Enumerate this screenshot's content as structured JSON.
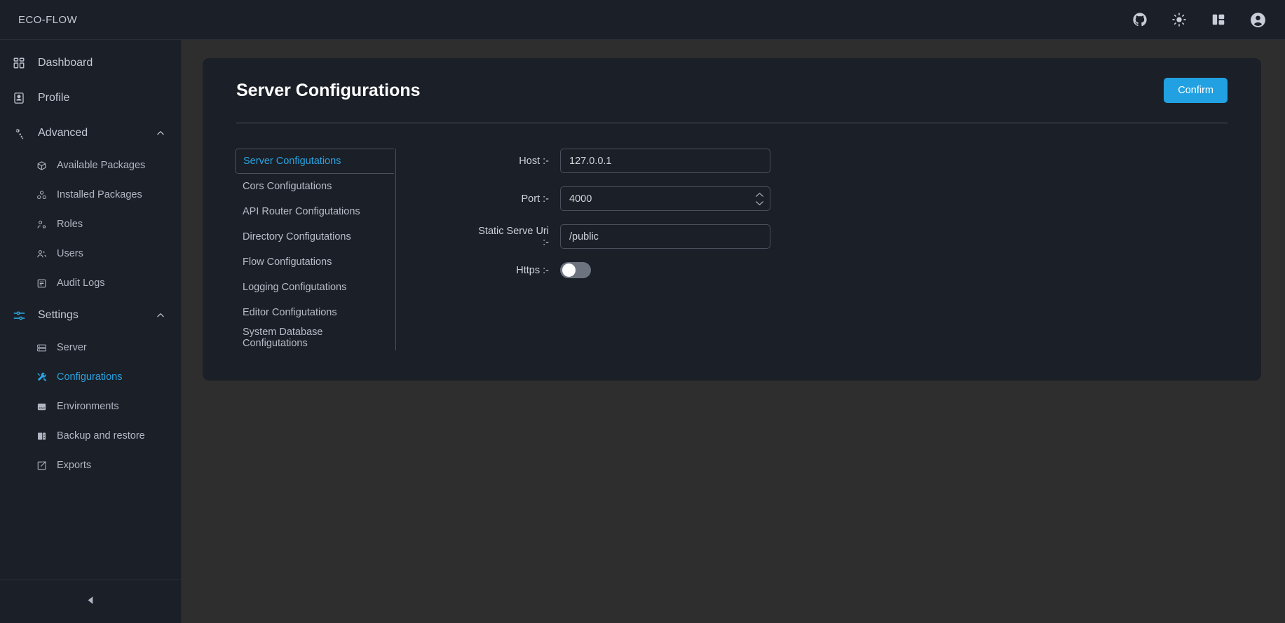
{
  "topbar": {
    "brand": "ECO-FLOW",
    "icons": [
      {
        "name": "github-icon",
        "title": "GitHub"
      },
      {
        "name": "sun-icon",
        "title": "Toggle theme"
      },
      {
        "name": "layout-panel-icon",
        "title": "Layout"
      },
      {
        "name": "account-circle-icon",
        "title": "Account"
      }
    ]
  },
  "sidebar": {
    "items": [
      {
        "label": "Dashboard",
        "icon": "dashboard-icon",
        "type": "nav"
      },
      {
        "label": "Profile",
        "icon": "profile-icon",
        "type": "nav"
      },
      {
        "label": "Advanced",
        "icon": "advanced-gear-icon",
        "type": "group",
        "expanded": true,
        "chevron": "chevron-up-icon"
      },
      {
        "label": "Available Packages",
        "icon": "package-icon",
        "type": "sub"
      },
      {
        "label": "Installed Packages",
        "icon": "installed-packages-icon",
        "type": "sub"
      },
      {
        "label": "Roles",
        "icon": "roles-icon",
        "type": "sub"
      },
      {
        "label": "Users",
        "icon": "users-icon",
        "type": "sub"
      },
      {
        "label": "Audit Logs",
        "icon": "audit-logs-icon",
        "type": "sub"
      },
      {
        "label": "Settings",
        "icon": "settings-sliders-icon",
        "type": "group",
        "expanded": true,
        "chevron": "chevron-up-icon"
      },
      {
        "label": "Server",
        "icon": "server-icon",
        "type": "sub"
      },
      {
        "label": "Configurations",
        "icon": "tools-icon",
        "type": "sub",
        "active": true
      },
      {
        "label": "Environments",
        "icon": "env-file-icon",
        "type": "sub"
      },
      {
        "label": "Backup and restore",
        "icon": "backup-restore-icon",
        "type": "sub"
      },
      {
        "label": "Exports",
        "icon": "exports-icon",
        "type": "sub"
      }
    ],
    "collapse": {
      "name": "collapse-sidebar-button",
      "icon": "caret-left-icon"
    }
  },
  "page": {
    "title": "Server Configurations",
    "confirm_label": "Confirm"
  },
  "tabs": [
    {
      "label": "Server Configutations",
      "active": true
    },
    {
      "label": "Cors Configutations",
      "active": false
    },
    {
      "label": "API Router Configutations",
      "active": false
    },
    {
      "label": "Directory Configutations",
      "active": false
    },
    {
      "label": "Flow Configutations",
      "active": false
    },
    {
      "label": "Logging Configutations",
      "active": false
    },
    {
      "label": "Editor Configutations",
      "active": false
    },
    {
      "label": "System Database Configutations",
      "active": false
    }
  ],
  "form": {
    "host": {
      "label": "Host :-",
      "value": "127.0.0.1",
      "placeholder": "Host"
    },
    "port": {
      "label": "Port :-",
      "value": "4000",
      "placeholder": "Port"
    },
    "static_serve_uri": {
      "label": "Static Serve Uri :-",
      "value": "/public",
      "placeholder": "Static Serve Uri"
    },
    "https": {
      "label": "Https :-",
      "value": "off"
    }
  },
  "colors": {
    "accent": "#29a3e0",
    "button": "#21a1e1",
    "panel": "#1b1f27",
    "background": "#2e2e2e",
    "border": "#4a515c"
  }
}
